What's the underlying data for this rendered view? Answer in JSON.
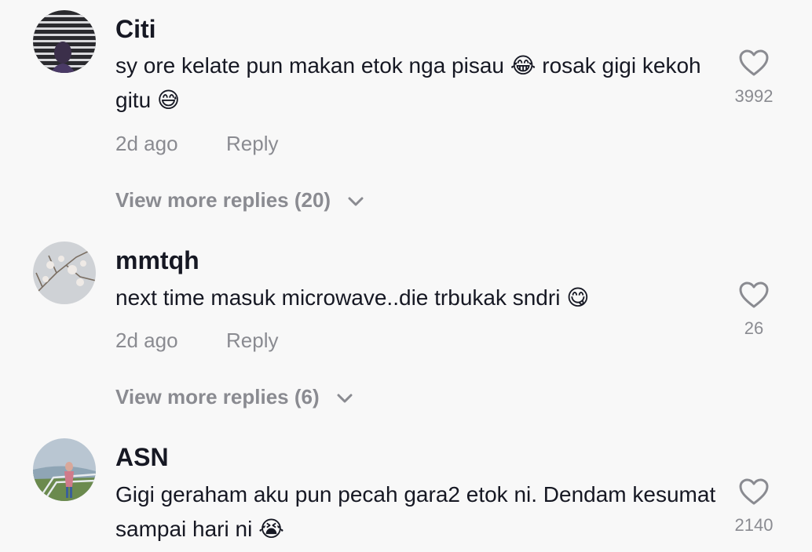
{
  "comments": [
    {
      "username": "Citi",
      "text": "sy ore kelate pun makan etok nga pisau 😂 rosak gigi kekoh gitu 😅",
      "time": "2d ago",
      "reply_label": "Reply",
      "likes": "3992",
      "view_more": "View more replies (20)"
    },
    {
      "username": "mmtqh",
      "text": "next time masuk microwave..die trbukak sndri 😋",
      "time": "2d ago",
      "reply_label": "Reply",
      "likes": "26",
      "view_more": "View more replies (6)"
    },
    {
      "username": "ASN",
      "text": "Gigi geraham aku pun pecah gara2 etok ni. Dendam kesumat sampai hari ni 😭",
      "likes": "2140"
    }
  ],
  "colors": {
    "background": "#f8f8f8",
    "primary_text": "#161823",
    "secondary_text": "#8a8b91"
  }
}
